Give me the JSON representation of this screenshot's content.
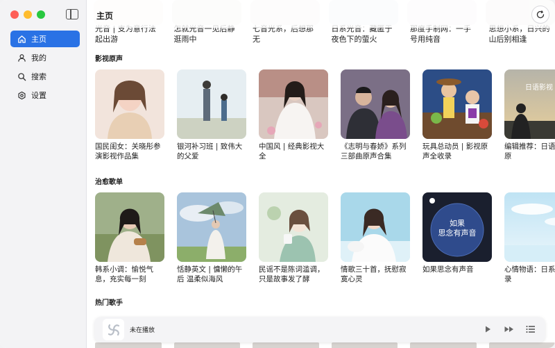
{
  "window": {
    "traffic_lights": [
      "close",
      "minimize",
      "zoom"
    ]
  },
  "sidebar": {
    "items": [
      {
        "label": "主页",
        "icon": "home-icon",
        "active": true
      },
      {
        "label": "我的",
        "icon": "person-icon",
        "active": false
      },
      {
        "label": "搜索",
        "icon": "search-icon",
        "active": false
      },
      {
        "label": "设置",
        "icon": "settings-icon",
        "active": false
      }
    ]
  },
  "header": {
    "title": "主页",
    "refresh_icon": "refresh-icon"
  },
  "top_row": {
    "captions": [
      "光音 | 支为意行法起出游",
      "怎就光音一见后静逛雨中",
      "七音光系，后想那无",
      "日系光音：藏匿于夜色下的萤火",
      "那度手制网：一手号用纯音",
      "思想小系，日兴的山后别相逢"
    ]
  },
  "sections": [
    {
      "title": "影视原声",
      "cards": [
        {
          "caption": "国民闺女：关晓彤参演影视作品集"
        },
        {
          "caption": "银河补习班 | 致伟大的父爱"
        },
        {
          "caption": "中国风 | 经典影视大全"
        },
        {
          "caption": "《志明与春娇》系列三部曲原声合集"
        },
        {
          "caption": "玩具总动员 | 影视原声全收录"
        },
        {
          "caption": "编辑推荐：日语影视原",
          "cover_text": "日语影视"
        }
      ]
    },
    {
      "title": "治愈歌单",
      "cards": [
        {
          "caption": "韩系小调：愉悦气息，充实每一刻"
        },
        {
          "caption": "恬静英文 | 慵懒的午后 温柔似海风"
        },
        {
          "caption": "民谣不是陈词滥调，只是故事发了酵"
        },
        {
          "caption": "情歌三十首，抚慰寂寞心灵"
        },
        {
          "caption": "如果思念有声音",
          "cover_text": "如果\n思念有声音"
        },
        {
          "caption": "心情物语：日系启示录"
        }
      ]
    },
    {
      "title": "热门歌手",
      "cards": []
    }
  ],
  "player": {
    "now_playing": "未在播放",
    "play_icon": "play-icon",
    "next_icon": "next-icon",
    "queue_icon": "queue-icon"
  },
  "colors": {
    "accent": "#2a72e5",
    "sidebar_bg": "#f3f3f5",
    "traffic_red": "#fe5f57",
    "traffic_yellow": "#febc2e",
    "traffic_green": "#28c840"
  }
}
